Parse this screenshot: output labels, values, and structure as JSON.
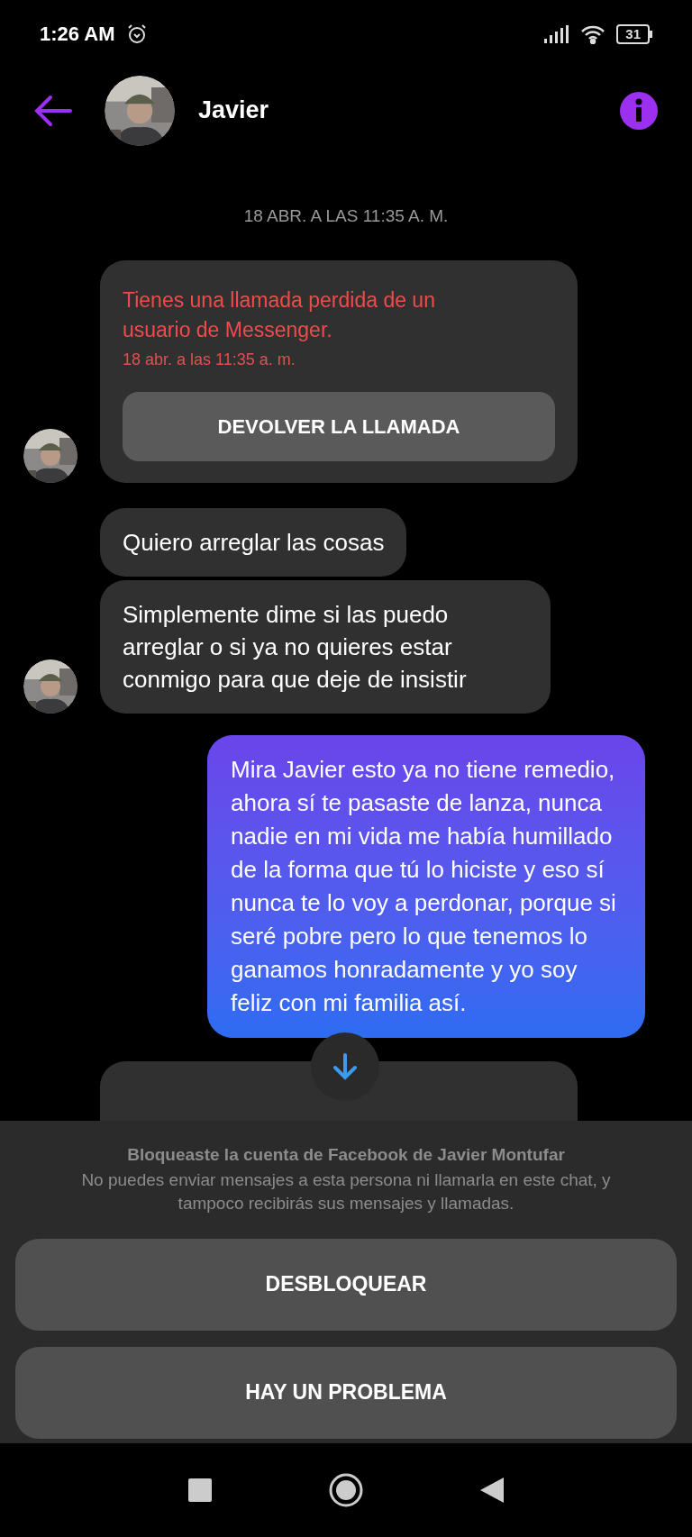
{
  "status_bar": {
    "time": "1:26 AM",
    "battery": "31"
  },
  "header": {
    "name": "Javier"
  },
  "messages": [
    {
      "kind": "date",
      "text": "18 ABR. A LAS 11:35 A. M."
    },
    {
      "kind": "missed_call",
      "title": "Tienes una llamada perdida de un usuario de Messenger.",
      "time": "18 abr. a las 11:35 a. m.",
      "button": "DEVOLVER LA LLAMADA",
      "avatar": true
    },
    {
      "kind": "incoming",
      "text": "Quiero arreglar las cosas",
      "avatar": false
    },
    {
      "kind": "incoming",
      "text": "Simplemente dime si las puedo arreglar o si ya no quieres estar conmigo para que deje de insistir",
      "avatar": true
    },
    {
      "kind": "outgoing",
      "text": "Mira Javier esto ya no tiene remedio, ahora sí te pasaste de lanza, nunca nadie en mi vida me había humillado de la forma que tú lo hiciste y eso sí nunca te lo voy a perdonar, porque si seré pobre pero lo que tenemos lo ganamos honradamente y yo soy feliz con mi familia así."
    },
    {
      "kind": "cut_off",
      "avatar": false
    }
  ],
  "block_notice": {
    "title": "Bloqueaste la cuenta de Facebook de Javier Montufar",
    "text": "No puedes enviar mensajes a esta persona ni llamarla en este chat, y tampoco recibirás sus mensajes y llamadas.",
    "buttons": [
      "DESBLOQUEAR",
      "HAY UN PROBLEMA"
    ]
  }
}
